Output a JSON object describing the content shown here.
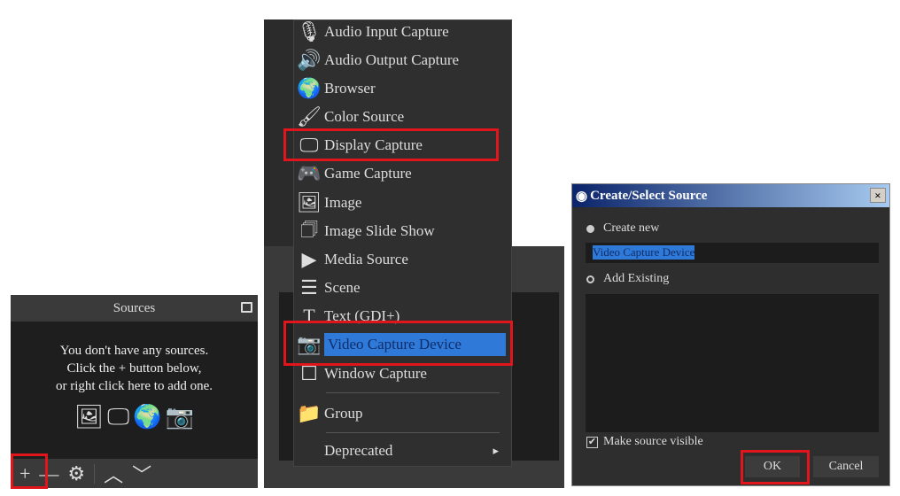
{
  "sources_panel": {
    "title": "Sources",
    "empty_message": [
      "You don't have any sources.",
      "Click the + button below,",
      "or right click here to add one."
    ],
    "toolbar": {
      "add": "+",
      "remove": "—",
      "settings": "⚙",
      "up": "︿",
      "down": "﹀"
    }
  },
  "menu": {
    "items": [
      {
        "label": "Audio Input Capture",
        "icon": "🎙"
      },
      {
        "label": "Audio Output Capture",
        "icon": "🔊"
      },
      {
        "label": "Browser",
        "icon": "🌍"
      },
      {
        "label": "Color Source",
        "icon": "🖌"
      },
      {
        "label": "Display Capture",
        "icon": "🖵"
      },
      {
        "label": "Game Capture",
        "icon": "🎮"
      },
      {
        "label": "Image",
        "icon": "🖼"
      },
      {
        "label": "Image Slide Show",
        "icon": "🗇"
      },
      {
        "label": "Media Source",
        "icon": "▶"
      },
      {
        "label": "Scene",
        "icon": "☰"
      },
      {
        "label": "Text (GDI+)",
        "icon": "T"
      },
      {
        "label": "Video Capture Device",
        "icon": "📷"
      },
      {
        "label": "Window Capture",
        "icon": "☐"
      },
      {
        "label": "Group",
        "icon": "📁"
      },
      {
        "label": "Deprecated",
        "icon": ""
      }
    ],
    "submenu_arrow": "▸"
  },
  "dialog": {
    "title": "Create/Select Source",
    "close": "×",
    "create_new": "Create new",
    "name_value": "Video Capture Device",
    "add_existing": "Add Existing",
    "make_visible": "Make source visible",
    "ok": "OK",
    "cancel": "Cancel"
  },
  "colors": {
    "highlight": "#e0161c",
    "selection": "#2f7ad8"
  }
}
